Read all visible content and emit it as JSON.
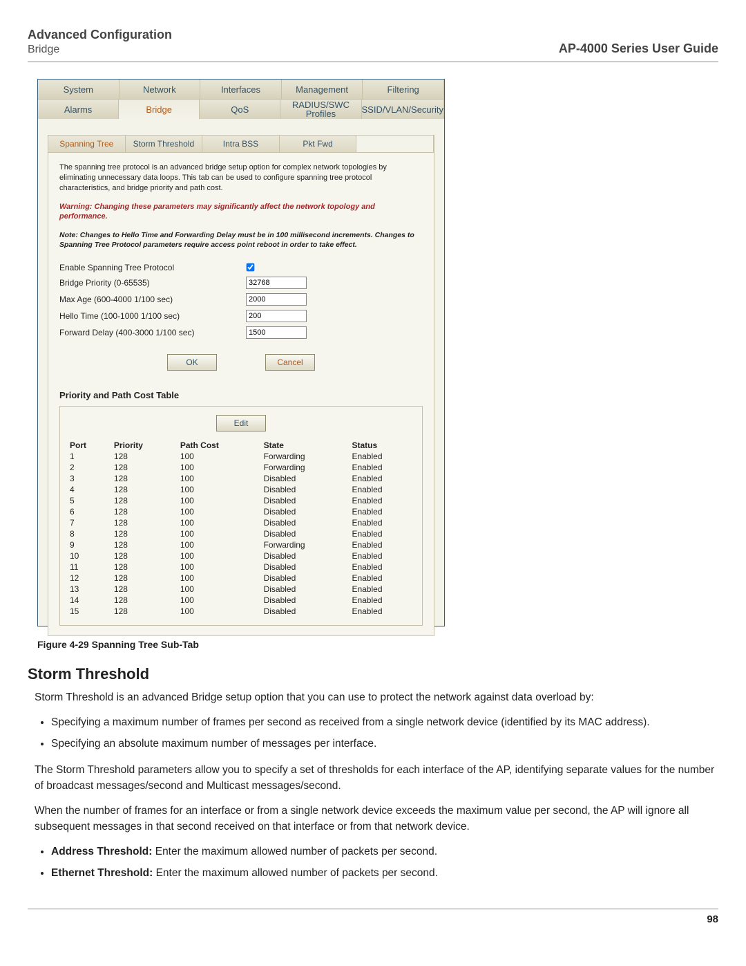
{
  "header": {
    "title": "Advanced Configuration",
    "subtitle": "Bridge",
    "guide": "AP-4000 Series User Guide"
  },
  "mainTabs1": [
    "System",
    "Network",
    "Interfaces",
    "Management",
    "Filtering"
  ],
  "mainTabs2": [
    "Alarms",
    "Bridge",
    "QoS",
    "RADIUS/SWC Profiles",
    "SSID/VLAN/Security"
  ],
  "mainSel2": 1,
  "subTabs": [
    "Spanning Tree",
    "Storm Threshold",
    "Intra BSS",
    "Pkt Fwd"
  ],
  "subSel": 0,
  "desc": "The spanning tree protocol is an advanced bridge setup option for complex network topologies by eliminating unnecessary data loops. This tab can be used to configure spanning tree protocol characteristics, and bridge priority and path cost.",
  "warn": "Warning: Changing these parameters may significantly affect the network topology and performance.",
  "note": "Note: Changes to Hello Time and Forwarding Delay must be in 100 millisecond increments. Changes to Spanning Tree Protocol parameters require access point reboot in order to take effect.",
  "form": {
    "enableLabel": "Enable Spanning Tree Protocol",
    "enableChecked": true,
    "priorityLabel": "Bridge Priority (0-65535)",
    "priorityVal": "32768",
    "maxAgeLabel": "Max Age (600-4000 1/100 sec)",
    "maxAgeVal": "2000",
    "helloLabel": "Hello Time (100-1000 1/100 sec)",
    "helloVal": "200",
    "fwdLabel": "Forward Delay (400-3000 1/100 sec)",
    "fwdVal": "1500"
  },
  "buttons": {
    "ok": "OK",
    "cancel": "Cancel",
    "edit": "Edit"
  },
  "tableTitle": "Priority and Path Cost Table",
  "cols": [
    "Port",
    "Priority",
    "Path Cost",
    "State",
    "Status"
  ],
  "rows": [
    {
      "port": "1",
      "priority": "128",
      "cost": "100",
      "state": "Forwarding",
      "status": "Enabled"
    },
    {
      "port": "2",
      "priority": "128",
      "cost": "100",
      "state": "Forwarding",
      "status": "Enabled"
    },
    {
      "port": "3",
      "priority": "128",
      "cost": "100",
      "state": "Disabled",
      "status": "Enabled"
    },
    {
      "port": "4",
      "priority": "128",
      "cost": "100",
      "state": "Disabled",
      "status": "Enabled"
    },
    {
      "port": "5",
      "priority": "128",
      "cost": "100",
      "state": "Disabled",
      "status": "Enabled"
    },
    {
      "port": "6",
      "priority": "128",
      "cost": "100",
      "state": "Disabled",
      "status": "Enabled"
    },
    {
      "port": "7",
      "priority": "128",
      "cost": "100",
      "state": "Disabled",
      "status": "Enabled"
    },
    {
      "port": "8",
      "priority": "128",
      "cost": "100",
      "state": "Disabled",
      "status": "Enabled"
    },
    {
      "port": "9",
      "priority": "128",
      "cost": "100",
      "state": "Forwarding",
      "status": "Enabled"
    },
    {
      "port": "10",
      "priority": "128",
      "cost": "100",
      "state": "Disabled",
      "status": "Enabled"
    },
    {
      "port": "11",
      "priority": "128",
      "cost": "100",
      "state": "Disabled",
      "status": "Enabled"
    },
    {
      "port": "12",
      "priority": "128",
      "cost": "100",
      "state": "Disabled",
      "status": "Enabled"
    },
    {
      "port": "13",
      "priority": "128",
      "cost": "100",
      "state": "Disabled",
      "status": "Enabled"
    },
    {
      "port": "14",
      "priority": "128",
      "cost": "100",
      "state": "Disabled",
      "status": "Enabled"
    },
    {
      "port": "15",
      "priority": "128",
      "cost": "100",
      "state": "Disabled",
      "status": "Enabled"
    }
  ],
  "caption": "Figure 4-29 Spanning Tree Sub-Tab",
  "sectionTitle": "Storm Threshold",
  "para1": "Storm Threshold is an advanced Bridge setup option that you can use to protect the network against data overload by:",
  "bul1": "Specifying a maximum number of frames per second as received from a single network device (identified by its MAC address).",
  "bul2": "Specifying an absolute maximum number of messages per interface.",
  "para2": "The Storm Threshold parameters allow you to specify a set of thresholds for each interface of the AP, identifying separate values for the number of broadcast messages/second and Multicast messages/second.",
  "para3": "When the number of frames for an interface or from a single network device exceeds the maximum value per second, the AP will ignore all subsequent messages in that second received on that interface or from that network device.",
  "bul3a": "Address Threshold:",
  "bul3b": " Enter the maximum allowed number of packets per second.",
  "bul4a": "Ethernet Threshold:",
  "bul4b": " Enter the maximum allowed number of packets per second.",
  "pageNum": "98"
}
